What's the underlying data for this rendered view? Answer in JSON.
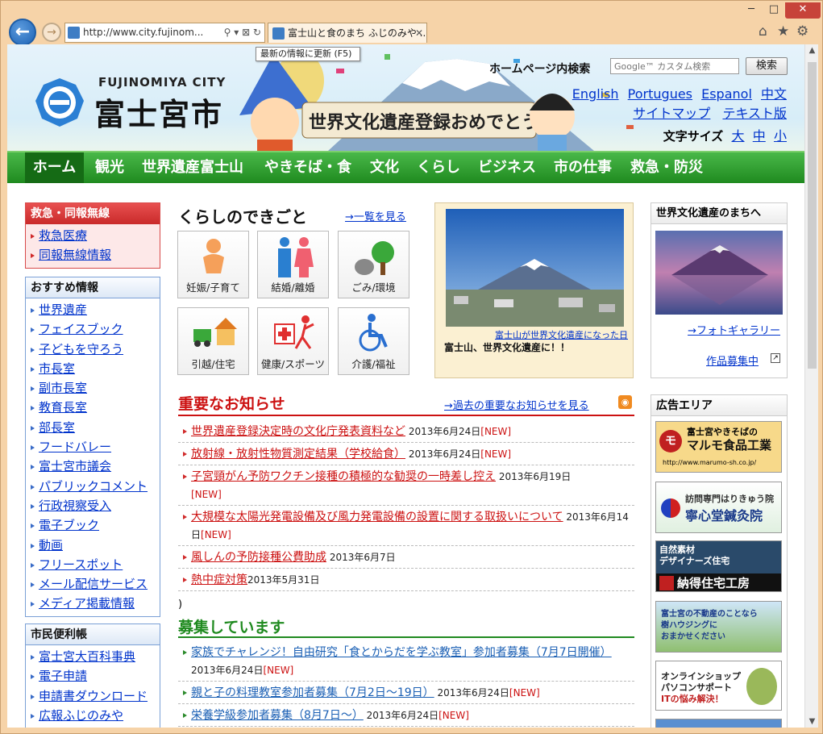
{
  "browser": {
    "address": "http://www.city.fujinom...",
    "tab_title": "富士山と食のまち ふじのみや ...",
    "tooltip": "最新の情報に更新 (F5)",
    "win_min": "─",
    "win_max": "□",
    "win_close": "✕"
  },
  "header": {
    "logo_en": "FUJINOMIYA CITY",
    "logo_ja": "富士宮市",
    "banner_text": "世界文化遺産登録おめでとう!!",
    "search_label": "ホームページ内検索",
    "search_placeholder": "Google™ カスタム検索",
    "search_button": "検索",
    "langs": [
      "English",
      "Portugues",
      "Espanol",
      "中文"
    ],
    "sitemap": "サイトマップ",
    "textver": "テキスト版",
    "fontsize_label": "文字サイズ",
    "font_large": "大",
    "font_mid": "中",
    "font_small": "小"
  },
  "nav": [
    "ホーム",
    "観光",
    "世界遺産富士山",
    "やきそば・食",
    "文化",
    "くらし",
    "ビジネス",
    "市の仕事",
    "救急・防災"
  ],
  "left": {
    "emergency_title": "救急・同報無線",
    "emergency_items": [
      "救急医療",
      "同報無線情報"
    ],
    "recommend_title": "おすすめ情報",
    "recommend_items": [
      "世界遺産",
      "フェイスブック",
      "子どもを守ろう",
      "市長室",
      "副市長室",
      "教育長室",
      "部長室",
      "フードバレー",
      "富士宮市議会",
      "パブリックコメント",
      "行政視察受入",
      "電子ブック",
      "動画",
      "フリースポット",
      "メール配信サービス",
      "メディア掲載情報"
    ],
    "citizen_title": "市民便利帳",
    "citizen_items": [
      "富士宮大百科事典",
      "電子申請",
      "申請書ダウンロード",
      "広報ふじのみや"
    ]
  },
  "life": {
    "title": "くらしのできごと",
    "more": "→一覧を見る",
    "tiles": [
      "妊娠/子育て",
      "結婚/離婚",
      "ごみ/環境",
      "引越/住宅",
      "健康/スポーツ",
      "介護/福祉"
    ]
  },
  "photo": {
    "link": "富士山が世界文化遺産になった日",
    "caption": "富士山、世界文化遺産に！！"
  },
  "notices": {
    "title": "重要なお知らせ",
    "more": "→過去の重要なお知らせを見る",
    "items": [
      {
        "text": "世界遺産登録決定時の文化庁発表資料など",
        "date": " 2013年6月24日",
        "new": "[NEW]"
      },
      {
        "text": "放射線・放射性物質測定結果（学校給食）",
        "date": " 2013年6月24日",
        "new": "[NEW]"
      },
      {
        "text": "子宮頸がん予防ワクチン接種の積極的な勧奨の一時差し控え",
        "date": " 2013年6月19日",
        "new": "[NEW]"
      },
      {
        "text": "大規模な太陽光発電設備及び風力発電設備の設置に関する取扱いについて",
        "date": " 2013年6月14日",
        "new": "[NEW]"
      },
      {
        "text": "風しんの予防接種公費助成",
        "date": " 2013年6月7日",
        "new": ""
      },
      {
        "text": "熱中症対策",
        "date": "2013年5月31日",
        "new": ""
      }
    ],
    "stray": ")"
  },
  "recruit": {
    "title": "募集しています",
    "items": [
      {
        "text": "家族でチャレンジ！自由研究「食とからだを学ぶ教室」参加者募集（7月7日開催）",
        "date": " 2013年6月24日",
        "new": "[NEW]"
      },
      {
        "text": "親と子の料理教室参加者募集（7月2日～19日）",
        "date": " 2013年6月24日",
        "new": "[NEW]"
      },
      {
        "text": "栄養学級参加者募集（8月7日～）",
        "date": " 2013年6月24日",
        "new": "[NEW]"
      }
    ]
  },
  "right": {
    "heritage_title": "世界文化遺産のまちへ",
    "gallery": "→フォトギャラリー",
    "works": "作品募集中",
    "ad_title": "広告エリア",
    "ads": [
      {
        "line1": "富士宮やきそばの",
        "line2": "マルモ食品工業",
        "line3": "http://www.marumo-sh.co.jp/"
      },
      {
        "line1": "訪問専門はりきゅう院",
        "line2": "寧心堂鍼灸院",
        "line3": ""
      },
      {
        "line1": "自然素材",
        "line2": "デザイナーズ住宅",
        "line3": "納得住宅工房"
      },
      {
        "line1": "富士宮の不動産のことなら",
        "line2": "樹ハウジングに",
        "line3": "おまかせください"
      },
      {
        "line1": "オンラインショップ",
        "line2": "パソコンサポート",
        "line3": "ITの悩み解決！"
      }
    ]
  },
  "colors": {
    "nav_green": "#2a9a2a",
    "notice_red": "#cc1111",
    "recruit_green": "#1f8a1f",
    "link_blue": "#0033cc"
  }
}
